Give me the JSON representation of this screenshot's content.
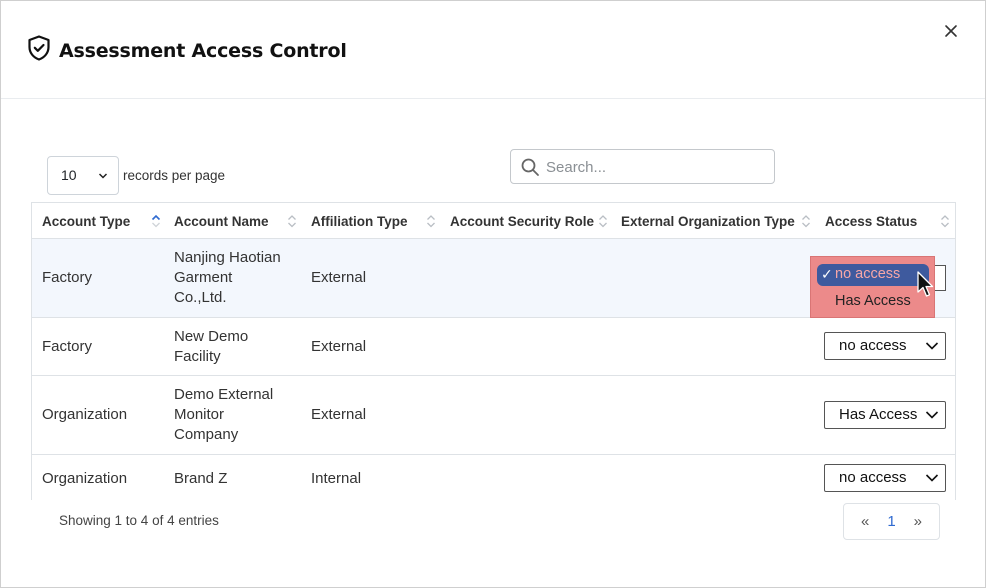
{
  "modal": {
    "title": "Assessment Access Control",
    "title_icon": "shield-check-icon",
    "close_icon": "close-icon"
  },
  "controls": {
    "page_length": "10",
    "page_length_label": "records per page",
    "search_placeholder": "Search...",
    "search_value": ""
  },
  "table": {
    "columns": [
      "Account Type",
      "Account Name",
      "Affiliation Type",
      "Account Security Role",
      "External Organization Type",
      "Access Status"
    ],
    "sorted_column": "Account Type",
    "sort_direction": "ascending",
    "rows": [
      {
        "account_type": "Factory",
        "account_name_lines": [
          "Nanjing Haotian",
          "Garment",
          "Co.,Ltd."
        ],
        "affiliation": "External",
        "security_role": "",
        "ext_org_type": "",
        "access_status": "no access"
      },
      {
        "account_type": "Factory",
        "account_name_lines": [
          "New Demo",
          "Facility"
        ],
        "affiliation": "External",
        "security_role": "",
        "ext_org_type": "",
        "access_status": "no access"
      },
      {
        "account_type": "Organization",
        "account_name_lines": [
          "Demo External",
          "Monitor",
          "Company"
        ],
        "affiliation": "External",
        "security_role": "",
        "ext_org_type": "",
        "access_status": "Has Access"
      },
      {
        "account_type": "Organization",
        "account_name_lines": [
          "Brand Z"
        ],
        "affiliation": "Internal",
        "security_role": "",
        "ext_org_type": "",
        "access_status": "no access"
      }
    ]
  },
  "dropdown_open": {
    "options": [
      "no access",
      "Has Access"
    ],
    "selected": "no access",
    "check_mark": "✓"
  },
  "footer": {
    "info": "Showing 1 to 4 of 4 entries",
    "prev_label": "«",
    "current_page": "1",
    "next_label": "»"
  },
  "colors": {
    "accent": "#2f6ad0",
    "dropdown_bg": "#ec8a8a",
    "dropdown_selected_bg": "#3e5a9e",
    "row_highlight": "#f3f7fd"
  }
}
